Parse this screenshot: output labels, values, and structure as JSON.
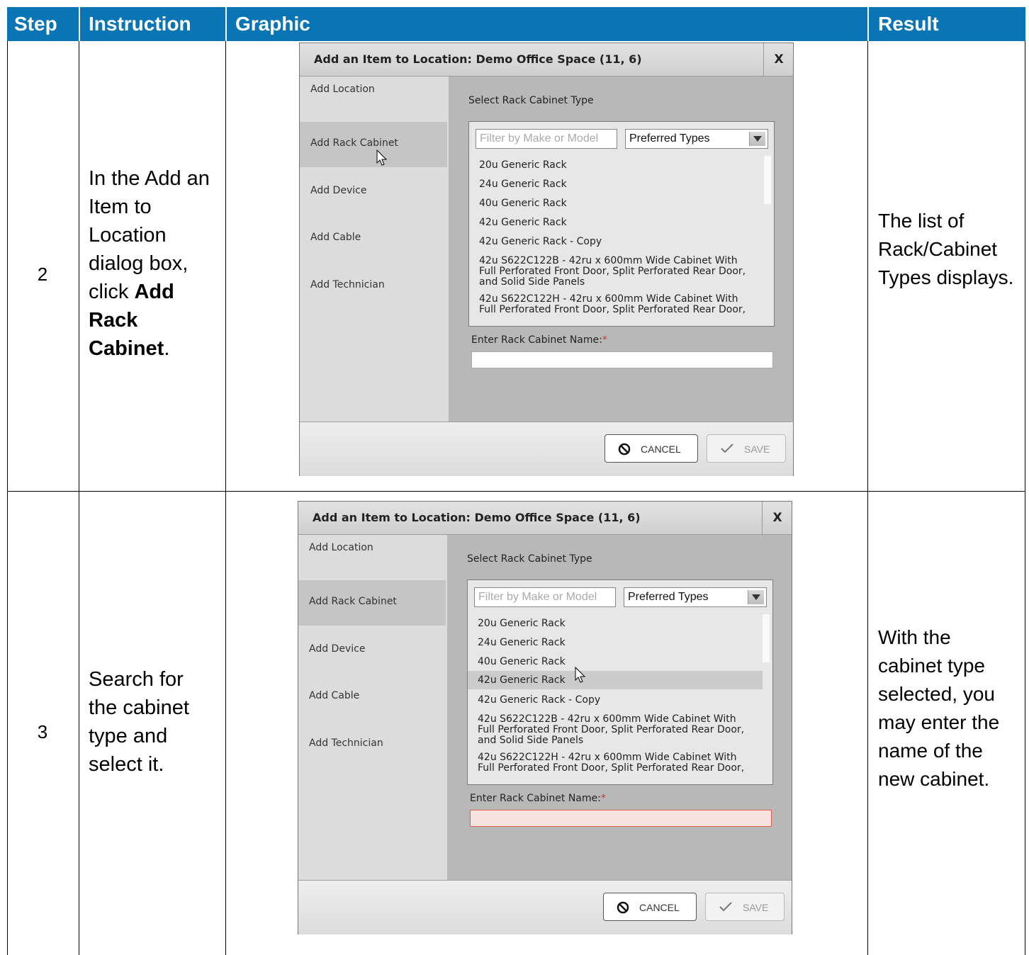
{
  "header": {
    "step": "Step",
    "instruction": "Instruction",
    "graphic": "Graphic",
    "result": "Result"
  },
  "colors": {
    "header_bg": "#0a75b4",
    "header_text": "#ffffff",
    "required": "#e03020"
  },
  "rows": [
    {
      "step": "2",
      "instruction_pre": "In the Add an Item to Location dialog box, click ",
      "instruction_bold": "Add Rack Cabinet",
      "instruction_post": ".",
      "result": "The list of Rack/Cabinet Types displays."
    },
    {
      "step": "3",
      "instruction": "Search for the cabinet type and select it.",
      "result": "With the cabinet type selected, you may enter the name of the new cabinet."
    }
  ],
  "dialog": {
    "title": "Add an Item to Location: Demo Office Space (11, 6)",
    "close_label": "X",
    "sidebar": [
      "Add Location",
      "Add Rack Cabinet",
      "Add Device",
      "Add Cable",
      "Add Technician"
    ],
    "select_type_label": "Select Rack Cabinet Type",
    "filter_placeholder": "Filter by Make or Model",
    "type_select_value": "Preferred Types",
    "options": [
      "20u Generic Rack",
      "24u Generic Rack",
      "40u Generic Rack",
      "42u Generic Rack",
      "42u Generic Rack - Copy",
      "42u S622C122B - 42ru x 600mm Wide Cabinet With",
      "Full Perforated Front Door, Split Perforated Rear Door,",
      "and Solid Side Panels",
      "42u S622C122H - 42ru x 600mm Wide Cabinet With",
      "Full Perforated Front Door, Split Perforated Rear Door,"
    ],
    "name_label": "Enter Rack Cabinet Name:",
    "required_mark": "*",
    "cancel_label": "CANCEL",
    "save_label": "SAVE"
  }
}
